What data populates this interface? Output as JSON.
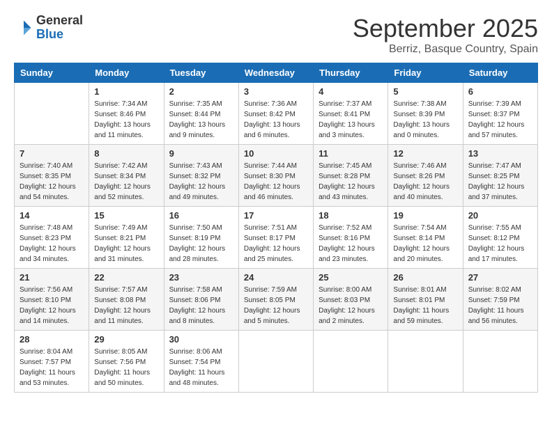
{
  "header": {
    "logo_general": "General",
    "logo_blue": "Blue",
    "title": "September 2025",
    "location": "Berriz, Basque Country, Spain"
  },
  "days_of_week": [
    "Sunday",
    "Monday",
    "Tuesday",
    "Wednesday",
    "Thursday",
    "Friday",
    "Saturday"
  ],
  "weeks": [
    [
      {
        "day": "",
        "sunrise": "",
        "sunset": "",
        "daylight": ""
      },
      {
        "day": "1",
        "sunrise": "Sunrise: 7:34 AM",
        "sunset": "Sunset: 8:46 PM",
        "daylight": "Daylight: 13 hours and 11 minutes."
      },
      {
        "day": "2",
        "sunrise": "Sunrise: 7:35 AM",
        "sunset": "Sunset: 8:44 PM",
        "daylight": "Daylight: 13 hours and 9 minutes."
      },
      {
        "day": "3",
        "sunrise": "Sunrise: 7:36 AM",
        "sunset": "Sunset: 8:42 PM",
        "daylight": "Daylight: 13 hours and 6 minutes."
      },
      {
        "day": "4",
        "sunrise": "Sunrise: 7:37 AM",
        "sunset": "Sunset: 8:41 PM",
        "daylight": "Daylight: 13 hours and 3 minutes."
      },
      {
        "day": "5",
        "sunrise": "Sunrise: 7:38 AM",
        "sunset": "Sunset: 8:39 PM",
        "daylight": "Daylight: 13 hours and 0 minutes."
      },
      {
        "day": "6",
        "sunrise": "Sunrise: 7:39 AM",
        "sunset": "Sunset: 8:37 PM",
        "daylight": "Daylight: 12 hours and 57 minutes."
      }
    ],
    [
      {
        "day": "7",
        "sunrise": "Sunrise: 7:40 AM",
        "sunset": "Sunset: 8:35 PM",
        "daylight": "Daylight: 12 hours and 54 minutes."
      },
      {
        "day": "8",
        "sunrise": "Sunrise: 7:42 AM",
        "sunset": "Sunset: 8:34 PM",
        "daylight": "Daylight: 12 hours and 52 minutes."
      },
      {
        "day": "9",
        "sunrise": "Sunrise: 7:43 AM",
        "sunset": "Sunset: 8:32 PM",
        "daylight": "Daylight: 12 hours and 49 minutes."
      },
      {
        "day": "10",
        "sunrise": "Sunrise: 7:44 AM",
        "sunset": "Sunset: 8:30 PM",
        "daylight": "Daylight: 12 hours and 46 minutes."
      },
      {
        "day": "11",
        "sunrise": "Sunrise: 7:45 AM",
        "sunset": "Sunset: 8:28 PM",
        "daylight": "Daylight: 12 hours and 43 minutes."
      },
      {
        "day": "12",
        "sunrise": "Sunrise: 7:46 AM",
        "sunset": "Sunset: 8:26 PM",
        "daylight": "Daylight: 12 hours and 40 minutes."
      },
      {
        "day": "13",
        "sunrise": "Sunrise: 7:47 AM",
        "sunset": "Sunset: 8:25 PM",
        "daylight": "Daylight: 12 hours and 37 minutes."
      }
    ],
    [
      {
        "day": "14",
        "sunrise": "Sunrise: 7:48 AM",
        "sunset": "Sunset: 8:23 PM",
        "daylight": "Daylight: 12 hours and 34 minutes."
      },
      {
        "day": "15",
        "sunrise": "Sunrise: 7:49 AM",
        "sunset": "Sunset: 8:21 PM",
        "daylight": "Daylight: 12 hours and 31 minutes."
      },
      {
        "day": "16",
        "sunrise": "Sunrise: 7:50 AM",
        "sunset": "Sunset: 8:19 PM",
        "daylight": "Daylight: 12 hours and 28 minutes."
      },
      {
        "day": "17",
        "sunrise": "Sunrise: 7:51 AM",
        "sunset": "Sunset: 8:17 PM",
        "daylight": "Daylight: 12 hours and 25 minutes."
      },
      {
        "day": "18",
        "sunrise": "Sunrise: 7:52 AM",
        "sunset": "Sunset: 8:16 PM",
        "daylight": "Daylight: 12 hours and 23 minutes."
      },
      {
        "day": "19",
        "sunrise": "Sunrise: 7:54 AM",
        "sunset": "Sunset: 8:14 PM",
        "daylight": "Daylight: 12 hours and 20 minutes."
      },
      {
        "day": "20",
        "sunrise": "Sunrise: 7:55 AM",
        "sunset": "Sunset: 8:12 PM",
        "daylight": "Daylight: 12 hours and 17 minutes."
      }
    ],
    [
      {
        "day": "21",
        "sunrise": "Sunrise: 7:56 AM",
        "sunset": "Sunset: 8:10 PM",
        "daylight": "Daylight: 12 hours and 14 minutes."
      },
      {
        "day": "22",
        "sunrise": "Sunrise: 7:57 AM",
        "sunset": "Sunset: 8:08 PM",
        "daylight": "Daylight: 12 hours and 11 minutes."
      },
      {
        "day": "23",
        "sunrise": "Sunrise: 7:58 AM",
        "sunset": "Sunset: 8:06 PM",
        "daylight": "Daylight: 12 hours and 8 minutes."
      },
      {
        "day": "24",
        "sunrise": "Sunrise: 7:59 AM",
        "sunset": "Sunset: 8:05 PM",
        "daylight": "Daylight: 12 hours and 5 minutes."
      },
      {
        "day": "25",
        "sunrise": "Sunrise: 8:00 AM",
        "sunset": "Sunset: 8:03 PM",
        "daylight": "Daylight: 12 hours and 2 minutes."
      },
      {
        "day": "26",
        "sunrise": "Sunrise: 8:01 AM",
        "sunset": "Sunset: 8:01 PM",
        "daylight": "Daylight: 11 hours and 59 minutes."
      },
      {
        "day": "27",
        "sunrise": "Sunrise: 8:02 AM",
        "sunset": "Sunset: 7:59 PM",
        "daylight": "Daylight: 11 hours and 56 minutes."
      }
    ],
    [
      {
        "day": "28",
        "sunrise": "Sunrise: 8:04 AM",
        "sunset": "Sunset: 7:57 PM",
        "daylight": "Daylight: 11 hours and 53 minutes."
      },
      {
        "day": "29",
        "sunrise": "Sunrise: 8:05 AM",
        "sunset": "Sunset: 7:56 PM",
        "daylight": "Daylight: 11 hours and 50 minutes."
      },
      {
        "day": "30",
        "sunrise": "Sunrise: 8:06 AM",
        "sunset": "Sunset: 7:54 PM",
        "daylight": "Daylight: 11 hours and 48 minutes."
      },
      {
        "day": "",
        "sunrise": "",
        "sunset": "",
        "daylight": ""
      },
      {
        "day": "",
        "sunrise": "",
        "sunset": "",
        "daylight": ""
      },
      {
        "day": "",
        "sunrise": "",
        "sunset": "",
        "daylight": ""
      },
      {
        "day": "",
        "sunrise": "",
        "sunset": "",
        "daylight": ""
      }
    ]
  ]
}
